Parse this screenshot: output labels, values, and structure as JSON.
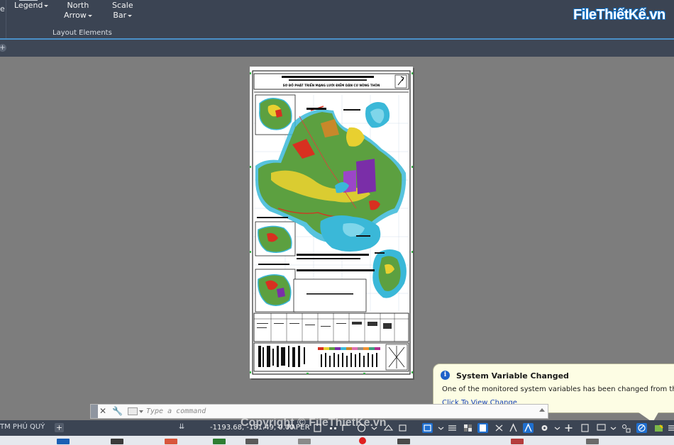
{
  "ribbon": {
    "edge_text": "e",
    "buttons": [
      {
        "line1": "Legend",
        "line2": ""
      },
      {
        "line1": "North",
        "line2": "Arrow"
      },
      {
        "line1": "Scale",
        "line2": "Bar"
      }
    ],
    "panel_label": "Layout Elements"
  },
  "logo": {
    "text": "FileThiếtKế.vn"
  },
  "drawing": {
    "title": "SƠ ĐỒ PHÁT TRIỂN MẠNG LƯỚI ĐIỂM DÂN CƯ NÔNG THÔN",
    "colors": {
      "land": "#5ca040",
      "water": "#3ab8d8",
      "urban": "#7a2ea8",
      "yellow": "#e8d030",
      "red": "#d83020"
    }
  },
  "notification": {
    "title": "System Variable Changed",
    "message": "One of the monitored system variables has been changed from the preferred value.",
    "link": "Click To View Change"
  },
  "command": {
    "placeholder": "Type a command"
  },
  "status": {
    "layout_tab": "TM PHÚ QUÝ",
    "menu_glyph": "⇊",
    "coordinates": "-1193.68, -181.49, 0.00",
    "space": "PAPER",
    "accent": "#1f6fcf"
  },
  "watermark": {
    "text": "Copyright © FileThietKe.vn"
  }
}
